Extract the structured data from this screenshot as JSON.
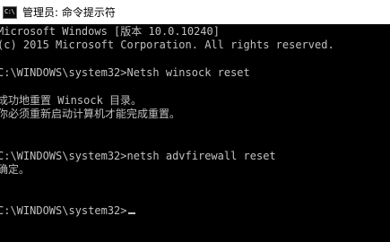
{
  "window": {
    "title": "管理员: 命令提示符",
    "icon": "cmd-icon",
    "icon_text": "C:\\"
  },
  "console": {
    "lines": [
      "Microsoft Windows [版本 10.0.10240]",
      "(c) 2015 Microsoft Corporation. All rights reserved.",
      "C:\\WINDOWS\\system32>Netsh winsock reset",
      "成功地重置 Winsock 目录。",
      "你必须重新启动计算机才能完成重置。",
      "C:\\WINDOWS\\system32>netsh advfirewall reset",
      "确定。",
      "C:\\WINDOWS\\system32>"
    ]
  },
  "colors": {
    "background": "#000000",
    "text": "#c0c0c0",
    "titlebar": "#ffffff"
  }
}
